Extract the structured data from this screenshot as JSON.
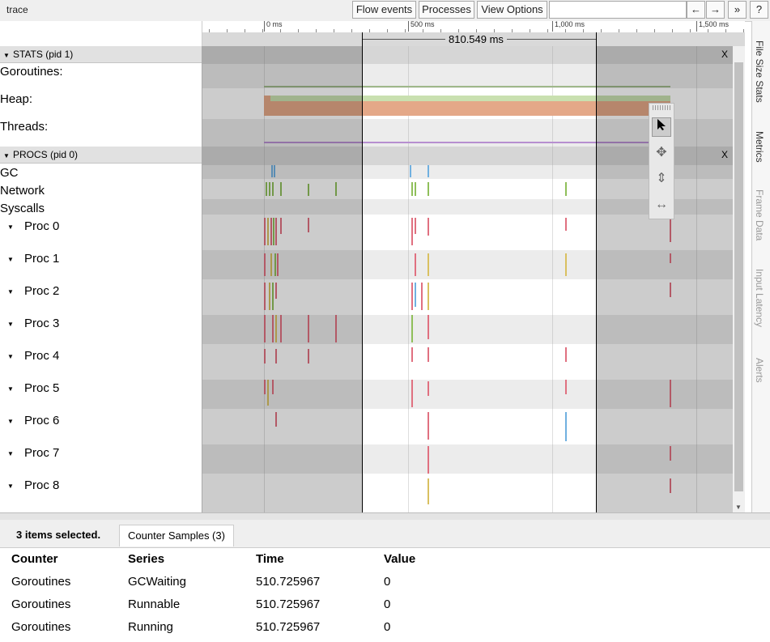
{
  "app": {
    "title": "trace"
  },
  "toolbar": {
    "flow_events": "Flow events",
    "processes": "Processes",
    "view_options": "View Options",
    "nav_back": "←",
    "nav_forward": "→",
    "more": "»",
    "help": "?"
  },
  "ruler": {
    "ticks": [
      "0 ms",
      "500 ms",
      "1,000 ms",
      "1,500 ms"
    ],
    "measure": "810.549 ms"
  },
  "groups": {
    "stats": {
      "label": "STATS (pid 1)",
      "close": "X",
      "tracks": [
        "Goroutines:",
        "Heap:",
        "Threads:"
      ]
    },
    "procs": {
      "label": "PROCS (pid 0)",
      "close": "X",
      "tracks": [
        "GC",
        "Network",
        "Syscalls"
      ],
      "procs": [
        "Proc 0",
        "Proc 1",
        "Proc 2",
        "Proc 3",
        "Proc 4",
        "Proc 5",
        "Proc 6",
        "Proc 7",
        "Proc 8"
      ]
    }
  },
  "side_tabs": [
    "File Size Stats",
    "Metrics",
    "Frame Data",
    "Input Latency",
    "Alerts"
  ],
  "tools": [
    "select-tool-icon",
    "pan-tool-icon",
    "zoom-tool-icon",
    "timing-tool-icon"
  ],
  "bottom": {
    "selection_count": "3 items selected.",
    "tab_label": "Counter Samples (3)",
    "columns": [
      "Counter",
      "Series",
      "Time",
      "Value"
    ],
    "rows": [
      [
        "Goroutines",
        "GCWaiting",
        "510.725967",
        "0"
      ],
      [
        "Goroutines",
        "Runnable",
        "510.725967",
        "0"
      ],
      [
        "Goroutines",
        "Running",
        "510.725967",
        "0"
      ]
    ]
  },
  "colors": {
    "heap_area": "#e4a888",
    "heap_top": "#c9e0b0",
    "threads_line": "#b78fd0",
    "slice_red": "#e07080",
    "slice_green": "#8fbf5a",
    "slice_yellow": "#d9c060",
    "slice_blue": "#70b0e0"
  }
}
